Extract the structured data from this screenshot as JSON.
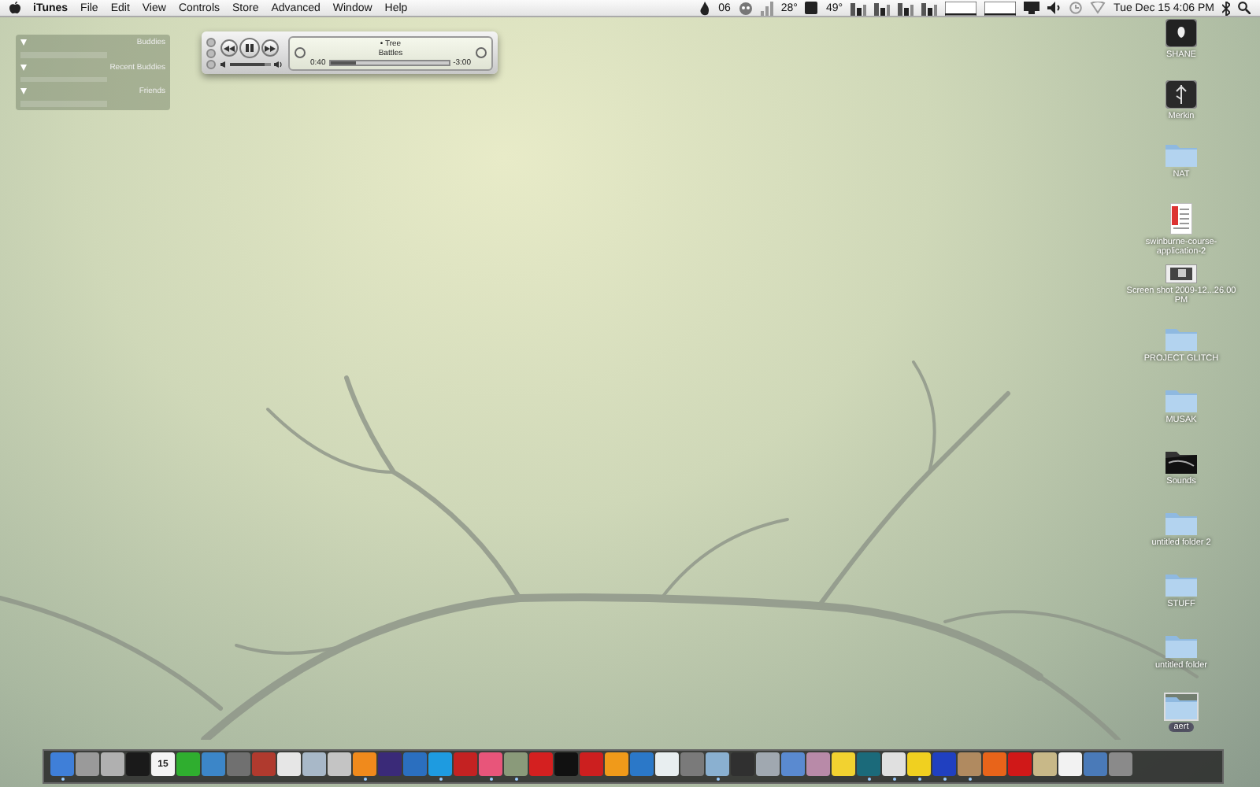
{
  "menu_bar": {
    "app_name": "iTunes",
    "menus": [
      "File",
      "Edit",
      "View",
      "Controls",
      "Store",
      "Advanced",
      "Window",
      "Help"
    ],
    "status": [
      {
        "kind": "flame"
      },
      {
        "kind": "text",
        "text": "06"
      },
      {
        "kind": "mascot"
      },
      {
        "kind": "bars"
      },
      {
        "kind": "text",
        "text": "28°"
      },
      {
        "kind": "square"
      },
      {
        "kind": "text",
        "text": "49°"
      },
      {
        "kind": "meter"
      },
      {
        "kind": "meter"
      },
      {
        "kind": "meter"
      },
      {
        "kind": "meter"
      },
      {
        "kind": "graph"
      },
      {
        "kind": "graph"
      },
      {
        "kind": "display"
      },
      {
        "kind": "volume"
      },
      {
        "kind": "clock"
      },
      {
        "kind": "wifi"
      },
      {
        "kind": "text",
        "text": "Tue Dec 15  4:06 PM"
      },
      {
        "kind": "bluetooth"
      },
      {
        "kind": "search"
      }
    ]
  },
  "buddy_widget": {
    "groups": [
      {
        "title": "Buddies",
        "expanded": true
      },
      {
        "title": "Recent Buddies",
        "expanded": true
      },
      {
        "title": "Friends",
        "expanded": true
      }
    ]
  },
  "mini_player": {
    "title": "• Tree",
    "artist": "Battles",
    "elapsed": "0:40",
    "remaining": "-3:00",
    "playing": true,
    "level": 0.22,
    "volume": {
      "level": 0.85
    }
  },
  "desktop_icons": [
    {
      "kind": "drive",
      "label": "SHANE",
      "selected": false
    },
    {
      "kind": "usb",
      "label": "Merkin",
      "selected": false
    },
    {
      "kind": "folder",
      "label": "NAT",
      "selected": false
    },
    {
      "kind": "document",
      "label": "swinburne-course-application-2",
      "selected": false
    },
    {
      "kind": "screenshot",
      "label": "Screen shot 2009-12...26.00 PM",
      "selected": false
    },
    {
      "kind": "folder",
      "label": "PROJECT GLITCH",
      "selected": false
    },
    {
      "kind": "folder",
      "label": "MUSAK",
      "selected": false
    },
    {
      "kind": "dark-folder",
      "label": "Sounds",
      "selected": false
    },
    {
      "kind": "folder",
      "label": "untitled folder 2",
      "selected": false
    },
    {
      "kind": "folder",
      "label": "STUFF",
      "selected": false
    },
    {
      "kind": "folder",
      "label": "untitled folder",
      "selected": false
    },
    {
      "kind": "folder",
      "label": "aert",
      "selected": true
    }
  ],
  "dock": [
    {
      "color": "#3f7fd8",
      "running": true
    },
    {
      "color": "#9a9a9a",
      "running": false
    },
    {
      "color": "#b0b0b0",
      "running": false
    },
    {
      "color": "#1a1a1a",
      "running": false
    },
    {
      "color": "#f4f4f4",
      "running": false,
      "label": "15"
    },
    {
      "color": "#2fae2f",
      "running": false
    },
    {
      "color": "#3c86c8",
      "running": false
    },
    {
      "color": "#707070",
      "running": false
    },
    {
      "color": "#b03a2e",
      "running": false
    },
    {
      "color": "#e6e6e6",
      "running": false
    },
    {
      "color": "#a8b8c8",
      "running": false
    },
    {
      "color": "#c4c4c4",
      "running": false
    },
    {
      "color": "#f08a1c",
      "running": true
    },
    {
      "color": "#3a2a78",
      "running": false
    },
    {
      "color": "#2b6fbf",
      "running": false
    },
    {
      "color": "#1e9be0",
      "running": true
    },
    {
      "color": "#c42222",
      "running": false
    },
    {
      "color": "#e8557a",
      "running": true
    },
    {
      "color": "#8a9a7a",
      "running": true
    },
    {
      "color": "#d42020",
      "running": false
    },
    {
      "color": "#111111",
      "running": false
    },
    {
      "color": "#cc1f1f",
      "running": false
    },
    {
      "color": "#f09a1a",
      "running": false
    },
    {
      "color": "#2b78c8",
      "running": false
    },
    {
      "color": "#e8eef0",
      "running": false
    },
    {
      "color": "#7a7a7a",
      "running": false
    },
    {
      "color": "#8ab0d0",
      "running": true
    },
    {
      "color": "#303030",
      "running": false
    },
    {
      "color": "#a0a8b0",
      "running": false
    },
    {
      "color": "#5a8ad0",
      "running": false
    },
    {
      "color": "#b88aa8",
      "running": false
    },
    {
      "color": "#f2d230",
      "running": false
    },
    {
      "color": "#1b6a7a",
      "running": true
    },
    {
      "color": "#e0e0e0",
      "running": true
    },
    {
      "color": "#f0d020",
      "running": true
    },
    {
      "color": "#2040c0",
      "running": true
    },
    {
      "color": "#b08a60",
      "running": true
    },
    {
      "color": "#e8641a",
      "running": false
    },
    {
      "color": "#d01818",
      "running": false
    },
    {
      "color": "#c8b888",
      "running": false
    },
    {
      "color": "#f2f2f2",
      "running": false
    },
    {
      "color": "#4a7ab8",
      "running": false
    },
    {
      "color": "#8a8a8a",
      "running": false
    }
  ]
}
